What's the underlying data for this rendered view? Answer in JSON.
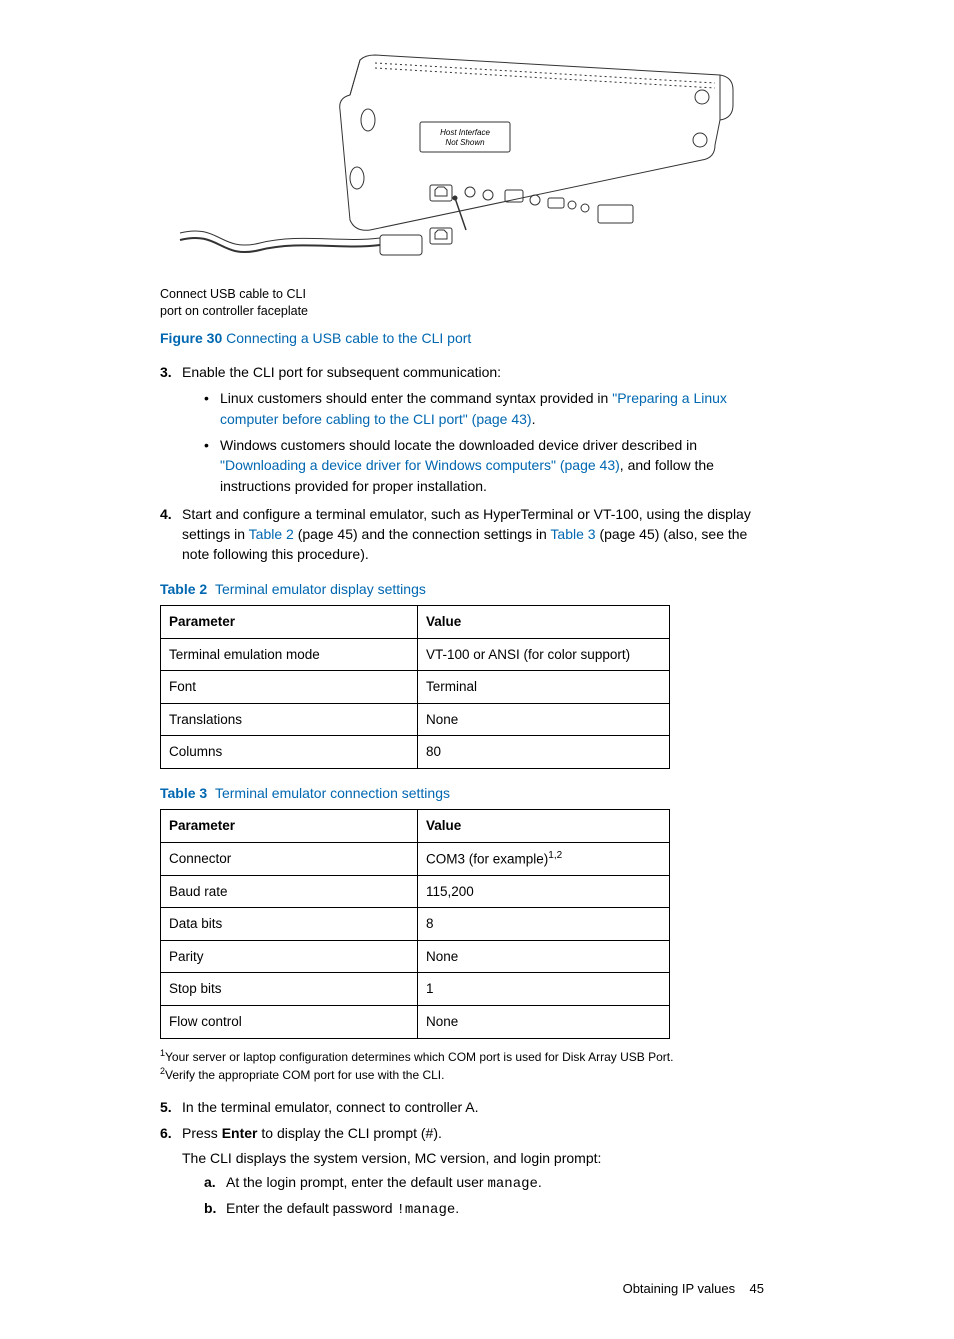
{
  "figure": {
    "img_label_l1": "Host Interface",
    "img_label_l2": "Not Shown",
    "caption_l1": "Connect USB cable to CLI",
    "caption_l2": "port on controller faceplate",
    "label": "Figure 30",
    "title": "Connecting a USB cable to the CLI port"
  },
  "step3": {
    "num": "3.",
    "text": "Enable the CLI port for subsequent communication:",
    "b1_pre": "Linux customers should enter the command syntax provided in ",
    "b1_link": "\"Preparing a Linux computer before cabling to the CLI port\" (page 43)",
    "b1_post": ".",
    "b2_pre": "Windows customers should locate the downloaded device driver described in ",
    "b2_link": "\"Downloading a device driver for Windows computers\" (page 43)",
    "b2_post": ", and follow the instructions provided for proper installation."
  },
  "step4": {
    "num": "4.",
    "pre": "Start and configure a terminal emulator, such as HyperTerminal or VT-100, using the display settings in ",
    "link1": "Table 2",
    "mid1": " (page 45) and the connection settings in ",
    "link2": "Table 3",
    "post": " (page 45) (also, see the note following this procedure)."
  },
  "table2": {
    "label": "Table 2",
    "title": "Terminal emulator display settings",
    "h1": "Parameter",
    "h2": "Value",
    "rows": [
      {
        "p": "Terminal emulation mode",
        "v": "VT-100 or ANSI (for color support)"
      },
      {
        "p": "Font",
        "v": "Terminal"
      },
      {
        "p": "Translations",
        "v": "None"
      },
      {
        "p": "Columns",
        "v": "80"
      }
    ]
  },
  "table3": {
    "label": "Table 3",
    "title": "Terminal emulator connection settings",
    "h1": "Parameter",
    "h2": "Value",
    "rows": [
      {
        "p": "Connector",
        "v": "COM3 (for example)",
        "sup": "1,2"
      },
      {
        "p": "Baud rate",
        "v": "115,200"
      },
      {
        "p": "Data bits",
        "v": "8"
      },
      {
        "p": "Parity",
        "v": "None"
      },
      {
        "p": "Stop bits",
        "v": "1"
      },
      {
        "p": "Flow control",
        "v": "None"
      }
    ]
  },
  "footnotes": {
    "f1": "Your server or laptop configuration determines which COM port is used for Disk Array USB Port.",
    "f2": "Verify the appropriate COM port for use with the CLI."
  },
  "step5": {
    "num": "5.",
    "text": "In the terminal emulator, connect to controller A."
  },
  "step6": {
    "num": "6.",
    "pre": "Press ",
    "bold": "Enter",
    "post": " to display the CLI prompt (#).",
    "line2": "The CLI displays the system version, MC version, and login prompt:",
    "a_num": "a.",
    "a_pre": "At the login prompt, enter the default user ",
    "a_mono": "manage",
    "a_post": ".",
    "b_num": "b.",
    "b_pre": "Enter the default password ",
    "b_mono": "!manage",
    "b_post": "."
  },
  "footer": {
    "section": "Obtaining IP values",
    "page": "45"
  }
}
